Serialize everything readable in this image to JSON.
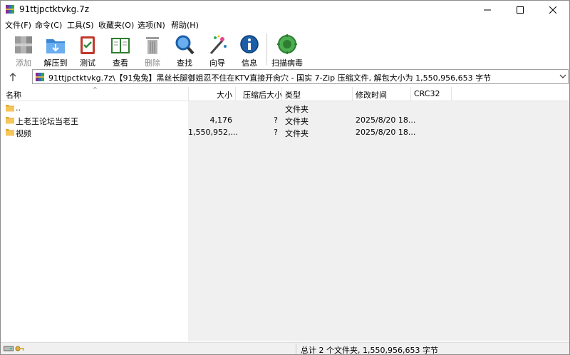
{
  "window": {
    "title": "91ttjpctktvkg.7z"
  },
  "menu": [
    "文件(F)",
    "命令(C)",
    "工具(S)",
    "收藏夹(O)",
    "选项(N)",
    "帮助(H)"
  ],
  "toolbar": {
    "add": "添加",
    "extract": "解压到",
    "test": "测试",
    "view": "查看",
    "delete": "删除",
    "find": "查找",
    "wizard": "向导",
    "info": "信息",
    "scan": "扫描病毒"
  },
  "address": {
    "text": "91ttjpctktvkg.7z\\【91兔兔】黑丝长腿御姐忍不住在KTV直接开肏穴 - 国实 7-Zip 压缩文件, 解包大小为 1,550,956,653 字节"
  },
  "columns": {
    "name": "名称",
    "size": "大小",
    "packed": "压缩后大小",
    "type": "类型",
    "modified": "修改时间",
    "crc": "CRC32"
  },
  "files": [
    {
      "name": "..",
      "size": "",
      "packed": "",
      "type": "文件夹",
      "modified": ""
    },
    {
      "name": "上老王论坛当老王",
      "size": "4,176",
      "packed": "?",
      "type": "文件夹",
      "modified": "2025/8/20 18..."
    },
    {
      "name": "视频",
      "size": "1,550,952,...",
      "packed": "?",
      "type": "文件夹",
      "modified": "2025/8/20 18..."
    }
  ],
  "status": {
    "summary": "总计 2 个文件夹, 1,550,956,653 字节"
  },
  "colors": {
    "folder": "#f6c659",
    "folder_dark": "#e2a93a",
    "accent": "#0078d7"
  }
}
